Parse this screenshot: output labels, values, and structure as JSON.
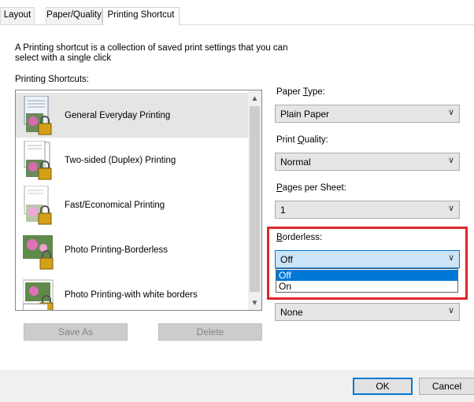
{
  "tabs": [
    {
      "label": "Layout"
    },
    {
      "label": "Paper/Quality"
    },
    {
      "label": "Printing Shortcut"
    }
  ],
  "description": {
    "line1": "A Printing shortcut is a collection of saved print settings that you can",
    "line2": "select with a single click"
  },
  "shortcuts": {
    "heading": "Printing Shortcuts:",
    "items": [
      {
        "label": "General Everyday Printing",
        "selected": true
      },
      {
        "label": "Two-sided (Duplex) Printing"
      },
      {
        "label": "Fast/Economical Printing"
      },
      {
        "label": "Photo Printing-Borderless"
      },
      {
        "label": "Photo Printing-with white borders"
      }
    ],
    "save_as": "Save As",
    "delete": "Delete"
  },
  "settings": {
    "paper_type": {
      "label_pre": "Paper ",
      "label_key": "T",
      "label_post": "ype:",
      "value": "Plain Paper"
    },
    "print_quality": {
      "label_pre": "Print ",
      "label_key": "Q",
      "label_post": "uality:",
      "value": "Normal"
    },
    "pages_per_sheet": {
      "label_pre": "",
      "label_key": "P",
      "label_post": "ages per Sheet:",
      "value": "1"
    },
    "borderless": {
      "label_pre": "",
      "label_key": "B",
      "label_post": "orderless:",
      "value": "Off",
      "options": [
        "Off",
        "On"
      ]
    },
    "hidden_field": {
      "value": "None"
    }
  },
  "footer": {
    "ok": "OK",
    "cancel": "Cancel"
  },
  "colors": {
    "highlight": "#0078d7",
    "callout": "#e0262b"
  }
}
